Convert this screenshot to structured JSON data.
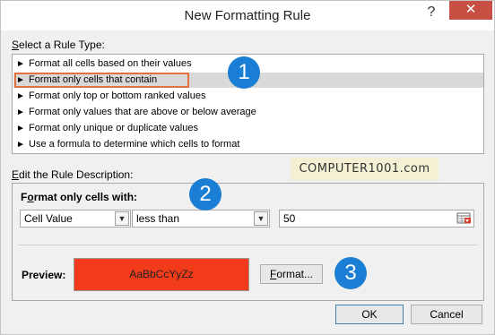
{
  "window": {
    "title": "New Formatting Rule",
    "help_glyph": "?",
    "close_glyph": "✕"
  },
  "select_section": {
    "label_prefix": "",
    "label_key": "S",
    "label_rest": "elect a Rule Type:"
  },
  "rule_types": [
    {
      "label": "Format all cells based on their values"
    },
    {
      "label": "Format only cells that contain"
    },
    {
      "label": "Format only top or bottom ranked values"
    },
    {
      "label": "Format only values that are above or below average"
    },
    {
      "label": "Format only unique or duplicate values"
    },
    {
      "label": "Use a formula to determine which cells to format"
    }
  ],
  "selected_index": 1,
  "arrow_glyph": "►",
  "watermark": "COMPUTER1001.com",
  "edit_section": {
    "label_key": "E",
    "label_rest": "dit the Rule Description:"
  },
  "format_only": {
    "label_key": "o",
    "label_before": "F",
    "label_after": "rmat only cells with:"
  },
  "condition": {
    "field": "Cell Value",
    "operator": "less than",
    "value": "50"
  },
  "preview": {
    "label": "Preview:",
    "sample": "AaBbCcYyZz",
    "fill_color": "#f23b1b"
  },
  "buttons": {
    "format": "Format...",
    "format_key": "F",
    "format_rest": "ormat...",
    "ok": "OK",
    "cancel": "Cancel"
  },
  "badges": [
    "1",
    "2",
    "3"
  ],
  "accent": "#1a7fd4"
}
